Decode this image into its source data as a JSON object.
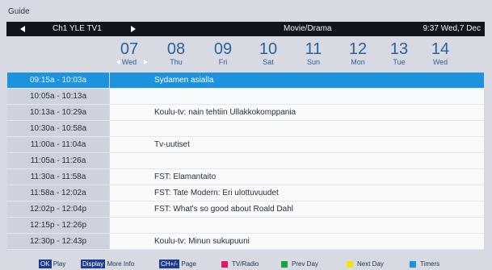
{
  "screen": {
    "title": "Guide"
  },
  "topbar": {
    "channel": "Ch1 YLE TV1",
    "genre": "Movie/Drama",
    "clock": "9:37 Wed,7 Dec"
  },
  "days": [
    {
      "num": "07",
      "name": "Wed"
    },
    {
      "num": "08",
      "name": "Thu"
    },
    {
      "num": "09",
      "name": "Fri"
    },
    {
      "num": "10",
      "name": "Sat"
    },
    {
      "num": "11",
      "name": "Sun"
    },
    {
      "num": "12",
      "name": "Mon"
    },
    {
      "num": "13",
      "name": "Tue"
    },
    {
      "num": "14",
      "name": "Wed"
    }
  ],
  "schedule": [
    {
      "time": "09:15a - 10:03a",
      "title": "Sydamen asialla"
    },
    {
      "time": "10:05a - 10:13a",
      "title": ""
    },
    {
      "time": "10:13a - 10:29a",
      "title": "Koulu-tv: nain tehtiin Ullakkokomppania"
    },
    {
      "time": "10:30a - 10:58a",
      "title": ""
    },
    {
      "time": "11:00a - 11:04a",
      "title": "Tv-uutiset"
    },
    {
      "time": "11:05a - 11:26a",
      "title": ""
    },
    {
      "time": "11:30a - 11:58a",
      "title": "FST: Elamantaito"
    },
    {
      "time": "11:58a - 12:02a",
      "title": "FST: Tate Modern: Eri ulottuvuudet"
    },
    {
      "time": "12:02p - 12:04p",
      "title": "FST: What's so good about Roald Dahl"
    },
    {
      "time": "12:15p - 12:26p",
      "title": ""
    },
    {
      "time": "12:30p - 12:43p",
      "title": "Koulu-tv: Minun sukupuuni"
    }
  ],
  "footer": {
    "ok_key": "OK",
    "ok_label": "Play",
    "display_key": "Display",
    "display_label": "More Info",
    "ch_key": "CH+/-",
    "ch_label": "Page",
    "red_label": "TV/Radio",
    "green_label": "Prev Day",
    "yellow_label": "Next Day",
    "blue_label": "Timers"
  },
  "colors": {
    "selected": "#1d93dd",
    "red": "#e1176f",
    "green": "#16a143",
    "yellow": "#f2e700",
    "blue": "#1d93dd"
  }
}
